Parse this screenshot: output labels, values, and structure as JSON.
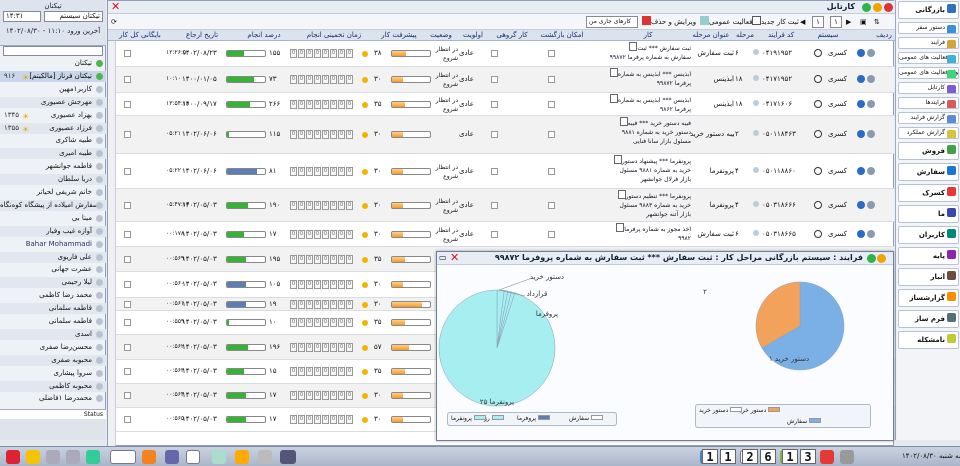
{
  "left_panel": {
    "title": "تیکتان",
    "user_select": "تیکتان سیستم",
    "time_select": "۱۴:۳۱",
    "login_text": "آخرین ورود ۱۱:۱۰ - ۱۴۰۲/۰۸/۳۰",
    "status_text": "Status",
    "people": [
      {
        "name": "تیکتان",
        "online": true,
        "count": "",
        "sun": false
      },
      {
        "name": "تیکتان فرناز [مالکیتم]",
        "online": true,
        "count": "۹۱۶",
        "sun": true
      },
      {
        "name": "کاربر۱مهین",
        "online": false,
        "count": "",
        "sun": false
      },
      {
        "name": "مهرجش عصیوری",
        "online": false,
        "count": "",
        "sun": false
      },
      {
        "name": "بهزاد عصیوری",
        "online": false,
        "count": "۱۳۴۵",
        "sun": true
      },
      {
        "name": "فرزاد عصیوری",
        "online": false,
        "count": "۱۳۵۵",
        "sun": true
      },
      {
        "name": "طبیه شاکری",
        "online": false,
        "count": "",
        "sun": false
      },
      {
        "name": "طیبه امیری",
        "online": false,
        "count": "",
        "sun": false
      },
      {
        "name": "فاطمه جوانشهر",
        "online": false,
        "count": "",
        "sun": false
      },
      {
        "name": "دریا سلطان",
        "online": false,
        "count": "",
        "sun": false
      },
      {
        "name": "خانم شریفی لحیاتر",
        "online": false,
        "count": "",
        "sun": false
      },
      {
        "name": "سفارش امیلاده از پیشگاه کوه‌نگاه",
        "online": false,
        "count": "",
        "sun": false
      },
      {
        "name": "مینا بی",
        "online": false,
        "count": "",
        "sun": false
      },
      {
        "name": "آوازه غیب وفیار",
        "online": false,
        "count": "",
        "sun": false
      },
      {
        "name": "Bahar Mohammadi",
        "online": false,
        "count": "",
        "sun": false,
        "latin": true
      },
      {
        "name": "علی ‌فاریوی",
        "online": false,
        "count": "",
        "sun": false
      },
      {
        "name": "عشرت جهانی",
        "online": false,
        "count": "",
        "sun": false
      },
      {
        "name": "لیلا رحیمی",
        "online": false,
        "count": "",
        "sun": false
      },
      {
        "name": "محمد رضا کاظمی",
        "online": false,
        "count": "",
        "sun": false
      },
      {
        "name": "فاطمه سلمانی",
        "online": false,
        "count": "",
        "sun": false
      },
      {
        "name": "فاطمه سلمانی",
        "online": false,
        "count": "",
        "sun": false
      },
      {
        "name": "اسدی",
        "online": false,
        "count": "",
        "sun": false
      },
      {
        "name": "محسن‌رضا صفری",
        "online": false,
        "count": "",
        "sun": false
      },
      {
        "name": "محبوبه صفری",
        "online": false,
        "count": "",
        "sun": false
      },
      {
        "name": "سروا پیشاری",
        "online": false,
        "count": "",
        "sun": false
      },
      {
        "name": "محبوبه کاظمی",
        "online": false,
        "count": "",
        "sun": false
      },
      {
        "name": "محمدرضا ۱فاضلی",
        "online": false,
        "count": "",
        "sun": false
      }
    ]
  },
  "main_window": {
    "title": "کارتابل",
    "toolbar": {
      "page_from": "۱",
      "page_to": "۱",
      "new_work": "ثبت کار جدید",
      "review": "فعالیت عمومی",
      "edit_delete": "ویرایش و حذف",
      "user_tasks_select": "کارهای جاری من"
    },
    "columns": {
      "row": "ردیف",
      "system": "سیستم",
      "process_code": "کد فرایند",
      "stage": "مرحله",
      "stage_title": "عنوان مرحله",
      "task": "کار",
      "return_possible": "امکان بازگشت",
      "group_work": "کار گروهی",
      "priority": "اولویت",
      "status": "وضعیت",
      "progress": "پیشرفت کار",
      "estimated_time": "زمان تخمینی انجام",
      "percent_done": "درصد انجام",
      "reference_date": "تاریخ ارجاع",
      "archive": "بایگانی کل کار"
    },
    "rows": [
      {
        "system": "کسری",
        "code": "۰۴۱۹۱۹۵۲",
        "stage": "۶",
        "stage_title": "ثبت سفارش",
        "task": "ثبت سفارش *** ثبت سفارش به شماره پرفرما ۹۹۸۷۲",
        "priority": "عادی",
        "status": "در انتظار شروع",
        "progress": 0.38,
        "progress_label": "۳۸",
        "percent": 0.45,
        "percent_label": "۱۵۵",
        "date": "۱۴۰۲/۰۸/۲۳",
        "time": "۱۲:۲۶:۵",
        "pcolor": "#35b335",
        "alt": false
      },
      {
        "system": "کسری",
        "code": "۰۴۱۷۱۹۵۲",
        "stage": "۱۸",
        "stage_title": "ابذینس",
        "task": "ابذینس *** ابذینس به شماره پرفرما ۹۹۸۷۲",
        "priority": "عادی",
        "status": "در انتظار شروع",
        "progress": 0.3,
        "progress_label": "۳۰",
        "percent": 0.7,
        "percent_label": "۷۳",
        "date": "۱۴۰۰/۰۱/۰۵",
        "time": "۱۰:۱۰",
        "pcolor": "#35b335",
        "alt": true
      },
      {
        "system": "کسری",
        "code": "۰۴۱۷۱۶۰۶",
        "stage": "۱۸",
        "stage_title": "ابذینس",
        "task": "ابذینس *** ابذینس به شماره پرفرما ۹۸۶۲",
        "priority": "عادی",
        "status": "در انتظار شروع",
        "progress": 0.35,
        "progress_label": "۳۵",
        "percent": 0.6,
        "percent_label": "۲۶۶",
        "date": "۱۴۰۰/۰۹/۱۷",
        "time": "۱۳:۵۴:۱۸",
        "pcolor": "#35b335",
        "alt": false
      },
      {
        "system": "کسری",
        "code": "۰۵۰۱۱۸۴۶۳",
        "stage": "۲",
        "stage_title": "فیبه دستور خرید",
        "task": "فیبه دستور خرید *** فیبه دستور خرید به شماره ۹۸۸۱ مسئول بازار سانا فنایی",
        "priority": "عادی",
        "status": "",
        "progress": 0.3,
        "progress_label": "۳۰",
        "percent": 0.05,
        "percent_label": "۱۱۵",
        "date": "۱۴۰۲/۰۶/۰۶",
        "time": "۰۵:۲۱",
        "pcolor": "#35b335",
        "alt": true
      },
      {
        "system": "کسری",
        "code": "۰۵۰۱۱۸۸۶۰",
        "stage": "۴",
        "stage_title": "پرونفرما",
        "task": "پرونفرما *** پیشنهاد دستور خرید به شماره ۹۸۸۱ مسئول بازار فرلال جوانشهر",
        "priority": "عادی",
        "status": "در انتظار شروع",
        "progress": 0.3,
        "progress_label": "۳۰",
        "percent": 0.8,
        "percent_label": "۸۱",
        "date": "۱۴۰۲/۰۶/۰۶",
        "time": "۰۵:۲۲",
        "pcolor": "#5b7fb5",
        "alt": false
      },
      {
        "system": "کسری",
        "code": "۰۵۰۳۱۸۶۶۶",
        "stage": "۴",
        "stage_title": "پرونفرما",
        "task": "پرونفرما *** تنظیم دستور خرید به شماره ۹۸۸۳ مسئول بازار آتنه جوانشهر",
        "priority": "عادی",
        "status": "در انتظار شروع",
        "progress": 0.3,
        "progress_label": "۳۰",
        "percent": 0.55,
        "percent_label": "۱۹۰",
        "date": "۱۴۰۲/۰۵/۰۳",
        "time": "۰۵:۴۷:۱۶",
        "pcolor": "#35b335",
        "alt": true
      },
      {
        "system": "کسری",
        "code": "۰۵۰۳۱۸۶۶۵",
        "stage": "۶",
        "stage_title": "ثبت سفارش",
        "task": "اخذ مجوز به شماره پرفرما ۹۹۸۲",
        "priority": "عادی",
        "status": "در انتظار شروع",
        "progress": 0.3,
        "progress_label": "۳۰",
        "percent": 0.45,
        "percent_label": "۱۷",
        "date": "۱۴۰۲/۰۵/۰۳",
        "time": "۰۰:۱۷۸",
        "pcolor": "#35b335",
        "alt": false
      },
      {
        "system": "",
        "code": "",
        "stage": "",
        "stage_title": "",
        "task": "",
        "priority": "عادی",
        "status": "",
        "progress": 0.35,
        "progress_label": "۳۵",
        "percent": 0.5,
        "percent_label": "۱۹۵",
        "date": "۱۴۰۲/۰۵/۰۳",
        "time": "۰۰:۵۶۹",
        "pcolor": "#35b335",
        "alt": true
      },
      {
        "system": "",
        "code": "",
        "stage": "",
        "stage_title": "",
        "task": "",
        "priority": "عادی",
        "status": "",
        "progress": 0.3,
        "progress_label": "۳۰",
        "percent": 0.5,
        "percent_label": "۱۰۵",
        "date": "۱۴۰۲/۰۵/۰۳",
        "time": "۰۰:۵۶۰",
        "pcolor": "#5b7fb5",
        "alt": false
      },
      {
        "system": "",
        "code": "",
        "stage": "",
        "stage_title": "",
        "task": "",
        "priority": "عادی",
        "status": "",
        "progress": 0.8,
        "progress_label": "۳۰",
        "percent": 0.5,
        "percent_label": "۱۹",
        "date": "۱۴۰۲/۰۵/۰۳",
        "time": "۰۰:۵۶۱",
        "pcolor": "#5b7fb5",
        "alt": true
      },
      {
        "system": "",
        "code": "",
        "stage": "",
        "stage_title": "",
        "task": "",
        "priority": "عادی",
        "status": "",
        "progress": 0.35,
        "progress_label": "۳۵",
        "percent": 0.05,
        "percent_label": "۱۰",
        "date": "۱۴۰۲/۰۵/۰۳",
        "time": "۰۰:۵۵۹",
        "pcolor": "#35b335",
        "alt": false
      },
      {
        "system": "",
        "code": "",
        "stage": "",
        "stage_title": "",
        "task": "",
        "priority": "عادی",
        "status": "",
        "progress": 0.45,
        "progress_label": "۵۷",
        "percent": 0.55,
        "percent_label": "۱۹۶",
        "date": "۱۴۰۲/۰۵/۰۳",
        "time": "۰۰:۵۶۲",
        "pcolor": "#35b335",
        "alt": true
      },
      {
        "system": "",
        "code": "",
        "stage": "",
        "stage_title": "",
        "task": "",
        "priority": "عادی",
        "status": "",
        "progress": 0.35,
        "progress_label": "۳۵",
        "percent": 0.45,
        "percent_label": "۱۵",
        "date": "۱۴۰۲/۰۵/۰۳",
        "time": "۰۰:۵۶۳",
        "pcolor": "#35b335",
        "alt": false
      },
      {
        "system": "",
        "code": "",
        "stage": "",
        "stage_title": "",
        "task": "",
        "priority": "عادی",
        "status": "",
        "progress": 0.3,
        "progress_label": "۳۰",
        "percent": 0.5,
        "percent_label": "۱۷",
        "date": "۱۴۰۲/۰۵/۰۳",
        "time": "۰۰:۵۶۴",
        "pcolor": "#35b335",
        "alt": true
      },
      {
        "system": "",
        "code": "",
        "stage": "",
        "stage_title": "",
        "task": "",
        "priority": "عادی",
        "status": "",
        "progress": 0.3,
        "progress_label": "۳۰",
        "percent": 0.5,
        "percent_label": "۱۷",
        "date": "۱۴۰۲/۰۵/۰۳",
        "time": "۰۰:۵۶۵",
        "pcolor": "#35b335",
        "alt": false
      }
    ]
  },
  "right_nav": {
    "items": [
      {
        "label": "بازرگانی",
        "big": true,
        "color": "#2f6fbf"
      },
      {
        "label": "دستور سفر",
        "big": false,
        "color": "#3b8fd6"
      },
      {
        "label": "فرایند",
        "big": false,
        "color": "#d6a23b"
      },
      {
        "label": "فعالیت های عمومی",
        "big": false,
        "color": "#3bb2d6"
      },
      {
        "label": "انواع فعالیت های عمومی",
        "big": false,
        "color": "#3bd67a"
      },
      {
        "label": "کارتابل",
        "big": false,
        "color": "#7c5bd6"
      },
      {
        "label": "فرایندها",
        "big": false,
        "color": "#d65b5b"
      },
      {
        "label": "گزارش فرایند",
        "big": false,
        "color": "#5b8bd6"
      },
      {
        "label": "گزارش عملکرد",
        "big": false,
        "color": "#d6c43b"
      },
      {
        "label": "فروش",
        "big": true,
        "color": "#43a047"
      },
      {
        "label": "سفارش",
        "big": true,
        "color": "#1976d2"
      },
      {
        "label": "کسرک",
        "big": true,
        "color": "#e53935"
      },
      {
        "label": "ما",
        "big": true,
        "color": "#3949ab"
      },
      {
        "label": "کاربران",
        "big": true,
        "color": "#00897b"
      },
      {
        "label": "پایه",
        "big": true,
        "color": "#8e24aa"
      },
      {
        "label": "انبار",
        "big": true,
        "color": "#6d4c41"
      },
      {
        "label": "گزارشساز",
        "big": true,
        "color": "#fb8c00"
      },
      {
        "label": "فرم ساز",
        "big": true,
        "color": "#546e7a"
      },
      {
        "label": "نامشکله",
        "big": true,
        "color": "#c0ca33"
      }
    ]
  },
  "chart_window": {
    "title": "فرایند : سیستم بازرگانی مراحل کار : ثبت سفارش *** ثبت سفارش به شماره پروفرما ۹۹۸۷۲",
    "chart_data": [
      {
        "type": "pie",
        "labels": [
          "پروفرما",
          "رزداد",
          "بازگرد خرید",
          "سفارش",
          "پرونفرما"
        ],
        "values": [
          2,
          1,
          1,
          1,
          95
        ],
        "colors": [
          "#a6eef0",
          "#a6eef0",
          "#a6eef0",
          "#a6eef0",
          "#a6eef0"
        ],
        "annotations": [
          "۲۵ پرونفرما",
          "پروفرما",
          "قرارداد",
          "دستور خرید"
        ],
        "legend": [
          "سفارش",
          "پروفرما",
          "رزداد",
          "پرونفرما"
        ]
      },
      {
        "type": "pie",
        "labels": [
          "دستور خرید",
          "دستور خرید"
        ],
        "values": [
          2,
          1
        ],
        "colors": [
          "#7ab0e6",
          "#f3a25c"
        ],
        "annotations": [
          "۲",
          "دستور خرید ۱"
        ],
        "legend": [
          "دستور خرید",
          "دستور خرید",
          "سفارش"
        ]
      }
    ]
  },
  "taskbar": {
    "date_text": "سه شنبه ۱۴۰۲/۰۸/۳۰",
    "clock": [
      "1",
      "1",
      "2",
      "6",
      "1",
      "3"
    ]
  }
}
